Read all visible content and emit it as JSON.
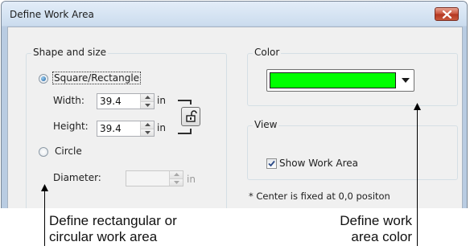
{
  "window": {
    "title": "Define Work Area"
  },
  "shape_group": {
    "label": "Shape and size",
    "square_option": "Square/Rectangle",
    "square_selected": true,
    "width_label": "Width:",
    "width_value": "39.4",
    "width_unit": "in",
    "height_label": "Height:",
    "height_value": "39.4",
    "height_unit": "in",
    "circle_option": "Circle",
    "circle_selected": false,
    "diameter_label": "Diameter:",
    "diameter_value": "",
    "diameter_unit": "in"
  },
  "color_group": {
    "label": "Color",
    "selected_color": "#00ff00"
  },
  "view_group": {
    "label": "View",
    "show_work_area_label": "Show Work Area",
    "show_work_area_checked": true
  },
  "note": "* Center is fixed at 0,0 positon",
  "callouts": {
    "left_line1": "Define rectangular or",
    "left_line2": "circular work area",
    "right_line1": "Define work",
    "right_line2": "area color"
  },
  "icons": {
    "close": "close-icon",
    "lock": "unlock-icon",
    "dropdown": "dropdown-arrow-icon"
  }
}
